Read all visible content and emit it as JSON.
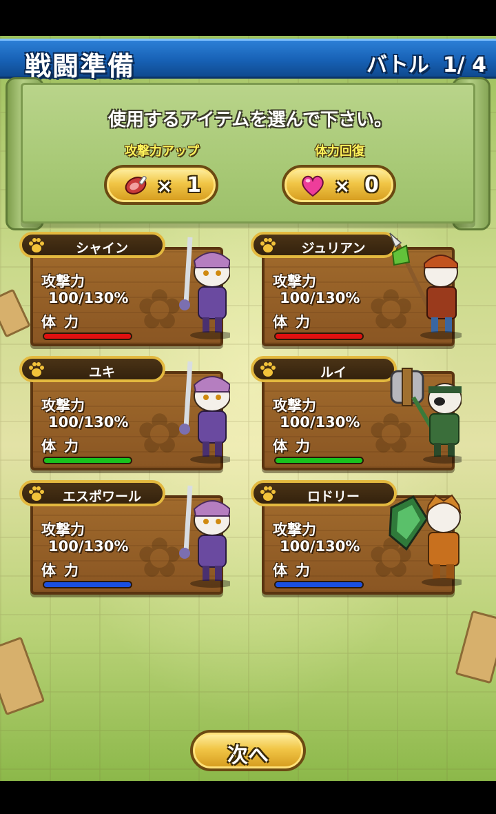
{
  "header": {
    "title": "戦闘準備",
    "battle_label": "バトル",
    "battle_progress": "1/ 4"
  },
  "items_panel": {
    "message": "使用するアイテムを選んで下さい。",
    "items": [
      {
        "label": "攻撃力アップ",
        "multiplier": "×",
        "count": "1",
        "icon": "meat-icon"
      },
      {
        "label": "体力回復",
        "multiplier": "×",
        "count": "0",
        "icon": "heart-icon"
      }
    ]
  },
  "cats": [
    {
      "name": "シャイン",
      "atk_label": "攻撃力",
      "atk_value": "100/130%",
      "hp_label": "体力",
      "hp_fill": 1.0,
      "hp_color": "#e01010",
      "icon": "cat-sword-icon"
    },
    {
      "name": "ジュリアン",
      "atk_label": "攻撃力",
      "atk_value": "100/130%",
      "hp_label": "体力",
      "hp_fill": 1.0,
      "hp_color": "#e01010",
      "icon": "cat-spear-icon"
    },
    {
      "name": "ユキ",
      "atk_label": "攻撃力",
      "atk_value": "100/130%",
      "hp_label": "体力",
      "hp_fill": 1.0,
      "hp_color": "#19c21f",
      "icon": "cat-sword-icon"
    },
    {
      "name": "ルイ",
      "atk_label": "攻撃力",
      "atk_value": "100/130%",
      "hp_label": "体力",
      "hp_fill": 1.0,
      "hp_color": "#19c21f",
      "icon": "cat-hammer-icon"
    },
    {
      "name": "エスポワール",
      "atk_label": "攻撃力",
      "atk_value": "100/130%",
      "hp_label": "体力",
      "hp_fill": 1.0,
      "hp_color": "#1a4fe0",
      "icon": "cat-sword-icon"
    },
    {
      "name": "ロドリー",
      "atk_label": "攻撃力",
      "atk_value": "100/130%",
      "hp_label": "体力",
      "hp_fill": 1.0,
      "hp_color": "#1a4fe0",
      "icon": "cat-shield-icon"
    }
  ],
  "next_button": {
    "label": "次へ"
  }
}
